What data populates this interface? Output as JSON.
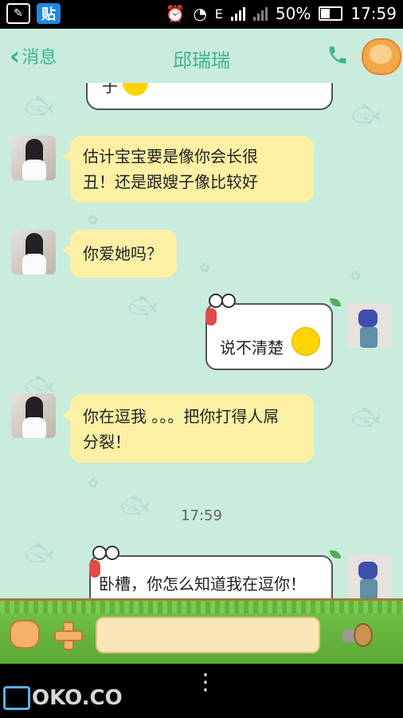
{
  "status_bar": {
    "notif_icon_1": "evernote-like-icon",
    "notif_icon_2": "tieba-icon",
    "notif_icon_2_text": "贴",
    "battery": "50%",
    "time": "17:59"
  },
  "header": {
    "back_label": "消息",
    "contact_name": "邱瑞瑞"
  },
  "messages": [
    {
      "side": "right",
      "text": "子"
    },
    {
      "side": "left",
      "text": "估计宝宝要是像你会长很丑！还是跟嫂子像比较好",
      "line1": "估计宝宝要是像你会长很",
      "line2": "丑！还是跟嫂子像比较好"
    },
    {
      "side": "left",
      "text": "你爱她吗？"
    },
    {
      "side": "right",
      "text": "说不清楚"
    },
    {
      "side": "left",
      "text": "你在逗我 。。。把你打得人屌分裂！",
      "line1": "你在逗我 。。。把你打得人屌",
      "line2": "分裂！"
    },
    {
      "side": "right",
      "text": "卧槽，你怎么知道我在逗你！"
    }
  ],
  "timestamp": "17:59",
  "input": {
    "value": "",
    "emoji_button": "cat-face-icon",
    "plus_button": "plus-icon",
    "voice_button": "horn-icon"
  },
  "watermark": "OKO.CO",
  "colors": {
    "chat_background": "#c9ecdd",
    "accent": "#3bb58d",
    "left_bubble": "#fbf0a4"
  }
}
